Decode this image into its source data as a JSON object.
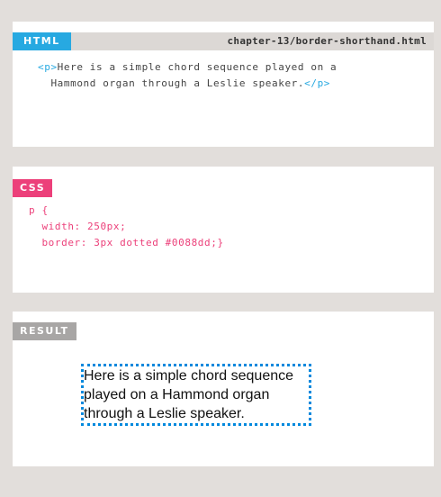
{
  "html_panel": {
    "label": "HTML",
    "filename": "chapter-13/border-shorthand.html",
    "code": {
      "open_tag": "<p>",
      "line1_text": "Here is a simple chord sequence played on a",
      "line2_text": "  Hammond organ through a Leslie speaker.",
      "close_tag": "</p>"
    }
  },
  "css_panel": {
    "label": "CSS",
    "code_lines": [
      "p {",
      "  width: 250px;",
      "  border: 3px dotted #0088dd;}"
    ]
  },
  "result_panel": {
    "label": "RESULT",
    "paragraph": "Here is a simple chord sequence played on a Hammond organ through a Leslie speaker."
  },
  "colors": {
    "html_tag": "#27a9e1",
    "css_tag": "#ec407a",
    "result_tag": "#a8a6a5",
    "border": "#0088dd"
  }
}
